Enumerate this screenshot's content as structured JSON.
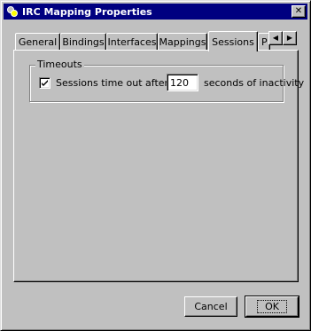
{
  "window": {
    "title": "IRC Mapping Properties",
    "close_glyph": "✕"
  },
  "tabs": [
    {
      "label": "General"
    },
    {
      "label": "Bindings"
    },
    {
      "label": "Interfaces"
    },
    {
      "label": "Mappings"
    },
    {
      "label": "Sessions"
    },
    {
      "label": "P"
    }
  ],
  "active_tab": "Sessions",
  "tab_scroll": {
    "left": "◀",
    "right": "▶"
  },
  "timeouts": {
    "group_label": "Timeouts",
    "checkbox_checked": true,
    "checkbox_label": "Sessions time out after",
    "value": "120",
    "suffix": "seconds of inactivity"
  },
  "buttons": {
    "cancel": "Cancel",
    "ok": "OK"
  },
  "colors": {
    "title_bar": "#000080",
    "face": "#c0c0c0"
  }
}
